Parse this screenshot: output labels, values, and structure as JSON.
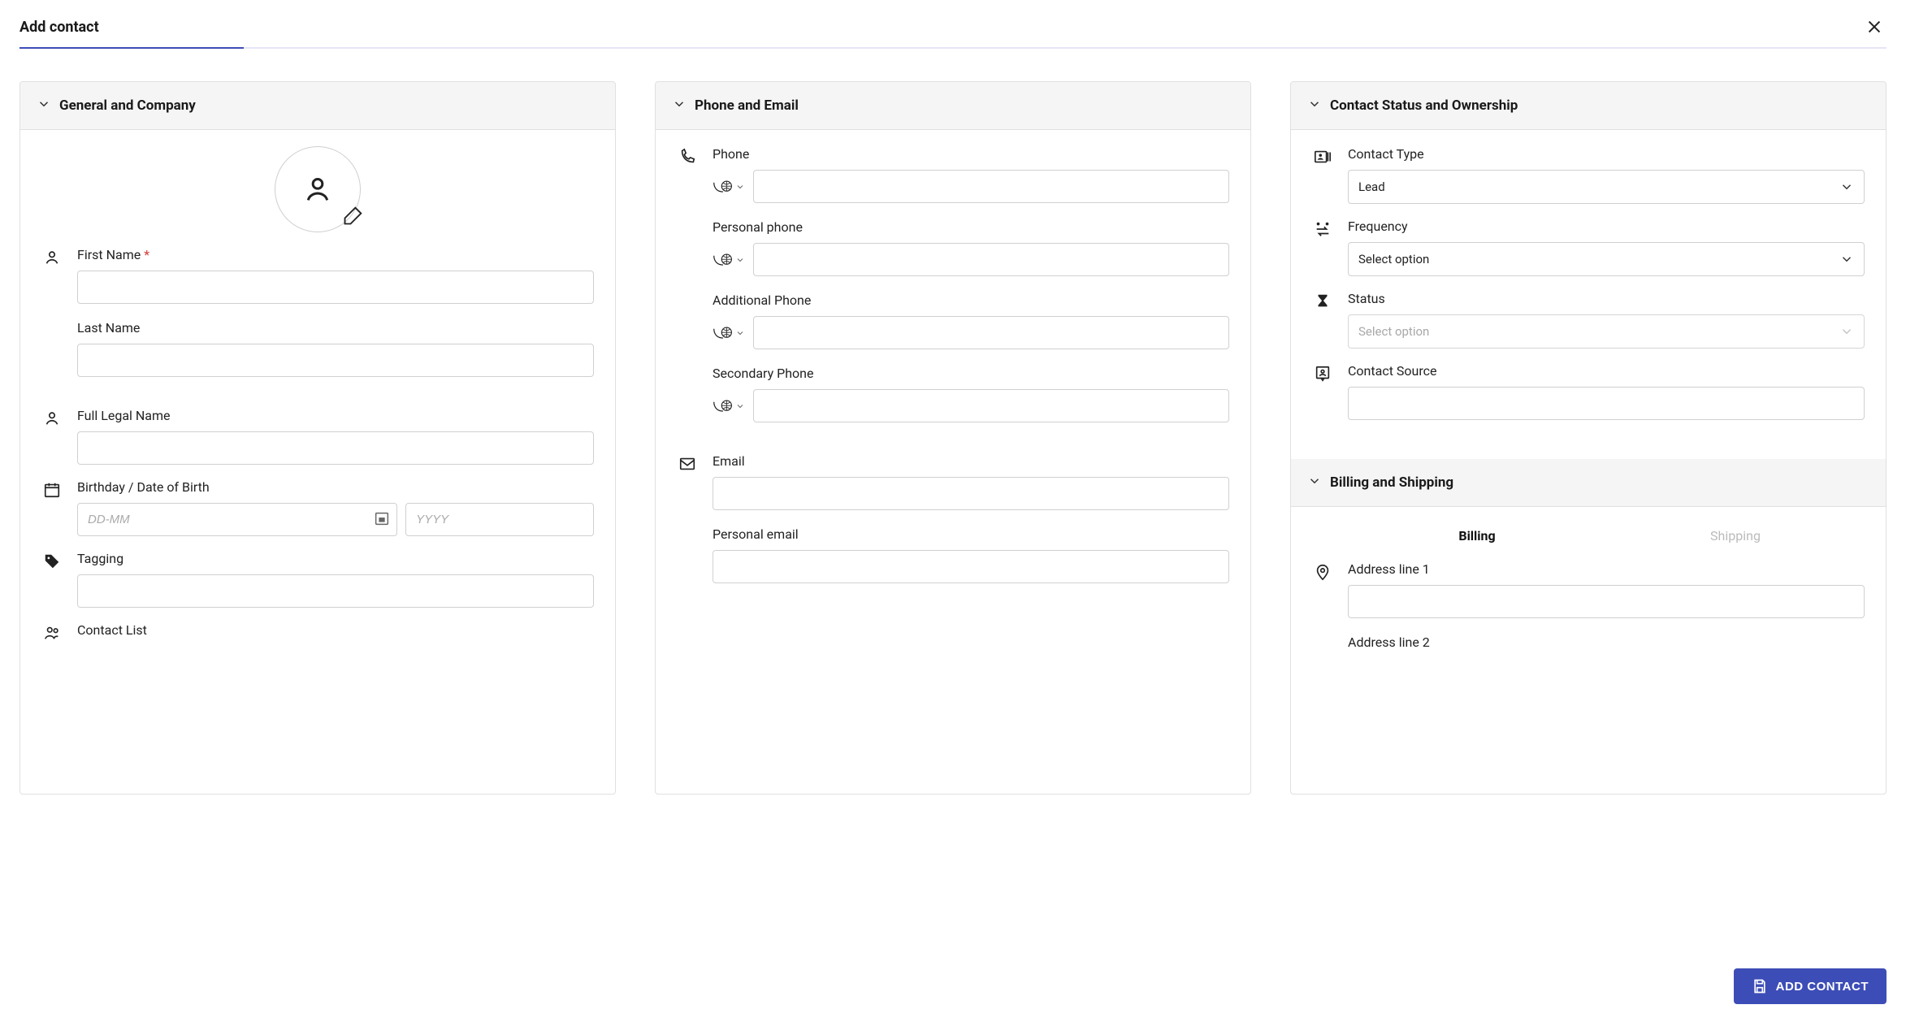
{
  "dialog": {
    "title": "Add contact"
  },
  "panels": {
    "general": {
      "title": "General and Company"
    },
    "phone_email": {
      "title": "Phone and Email"
    },
    "status_owner": {
      "title": "Contact Status and Ownership"
    },
    "billing_shipping": {
      "title": "Billing and Shipping"
    }
  },
  "general": {
    "first_name": {
      "label": "First Name",
      "value": ""
    },
    "last_name": {
      "label": "Last Name",
      "value": ""
    },
    "full_legal_name": {
      "label": "Full Legal Name",
      "value": ""
    },
    "birthday": {
      "label": "Birthday / Date of Birth",
      "day_placeholder": "DD-MM",
      "year_placeholder": "YYYY",
      "day_value": "",
      "year_value": ""
    },
    "tagging": {
      "label": "Tagging",
      "value": ""
    },
    "contact_list": {
      "label": "Contact List",
      "value": ""
    }
  },
  "phone": {
    "phone": {
      "label": "Phone",
      "value": ""
    },
    "personal_phone": {
      "label": "Personal phone",
      "value": ""
    },
    "additional_phone": {
      "label": "Additional Phone",
      "value": ""
    },
    "secondary_phone": {
      "label": "Secondary Phone",
      "value": ""
    }
  },
  "email": {
    "email": {
      "label": "Email",
      "value": ""
    },
    "personal_email": {
      "label": "Personal email",
      "value": ""
    }
  },
  "status": {
    "contact_type": {
      "label": "Contact Type",
      "value": "Lead"
    },
    "frequency": {
      "label": "Frequency",
      "value": "Select option"
    },
    "status": {
      "label": "Status",
      "placeholder": "Select option"
    },
    "contact_source": {
      "label": "Contact Source",
      "value": ""
    }
  },
  "billing": {
    "tab_billing": "Billing",
    "tab_shipping": "Shipping",
    "address1": {
      "label": "Address line 1",
      "value": ""
    },
    "address2": {
      "label": "Address line 2",
      "value": ""
    }
  },
  "footer": {
    "add_button": "ADD CONTACT"
  }
}
